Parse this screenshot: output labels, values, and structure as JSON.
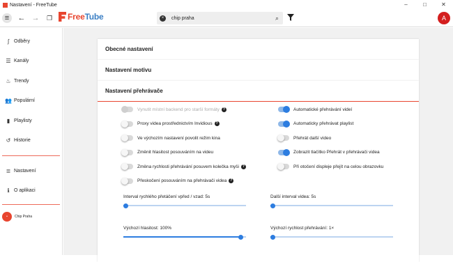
{
  "window": {
    "title": "Nastavení - FreeTube",
    "minimize": "–",
    "maximize": "□",
    "close": "✕"
  },
  "topbar": {
    "logo_part1": "Free",
    "logo_part2": "Tube",
    "search": {
      "value": "chip praha",
      "clear_glyph": "×",
      "search_glyph": "⌕"
    },
    "avatar_letter": "A",
    "back_glyph": "←",
    "forward_glyph": "→",
    "menu_glyph": "≡",
    "new_window_glyph": "❐"
  },
  "sidebar": {
    "items": [
      {
        "label": "Odběry",
        "icon": "rss-icon",
        "glyph": "ʃ"
      },
      {
        "label": "Kanály",
        "icon": "list-icon",
        "glyph": "☰"
      },
      {
        "label": "Trendy",
        "icon": "fire-icon",
        "glyph": "♨"
      },
      {
        "label": "Populární",
        "icon": "users-icon",
        "glyph": "👥"
      },
      {
        "label": "Playlisty",
        "icon": "bookmark-icon",
        "glyph": "▮"
      },
      {
        "label": "Historie",
        "icon": "history-icon",
        "glyph": "↺"
      }
    ],
    "bottom_items": [
      {
        "label": "Nastavení",
        "icon": "sliders-icon",
        "glyph": "≣"
      },
      {
        "label": "O aplikaci",
        "icon": "info-icon",
        "glyph": "ℹ"
      }
    ],
    "profile": {
      "label": "Chip Praha",
      "initial": "•"
    }
  },
  "sections": {
    "general": "Obecné nastavení",
    "theme": "Nastavení motivu",
    "player": "Nastavení přehrávače"
  },
  "player_options_left": [
    {
      "label": "Vynutit místní backend pro starší formáty",
      "on": false,
      "disabled": true,
      "help": true
    },
    {
      "label": "Proxy videa prostřednictvím Invidious",
      "on": false,
      "disabled": false,
      "help": true
    },
    {
      "label": "Ve výchozím nastavení povolit režim kina",
      "on": false,
      "disabled": false,
      "help": false
    },
    {
      "label": "Změnit hlasitost posouváním na videu",
      "on": false,
      "disabled": false,
      "help": false
    },
    {
      "label": "Změna rychlosti přehrávání posuvem kolečka myši",
      "on": false,
      "disabled": false,
      "help": true
    },
    {
      "label": "Přeskočení posouváním na přehrávači videa",
      "on": false,
      "disabled": false,
      "help": true
    }
  ],
  "player_options_right": [
    {
      "label": "Automatické přehrávání videí",
      "on": true
    },
    {
      "label": "Automaticky přehrávat playlist",
      "on": true
    },
    {
      "label": "Přehrát další video",
      "on": false
    },
    {
      "label": "Zobrazit tlačítko Přehrát v přehrávači videa",
      "on": true
    },
    {
      "label": "Při otočení displeje přejít na celou obrazovku",
      "on": false
    }
  ],
  "sliders": [
    {
      "label": "Interval rychlého přetáčení vpřed / vzad: 5s",
      "fraction": 0.0
    },
    {
      "label": "Další interval videa: 5s",
      "fraction": 0.0
    },
    {
      "label": "Výchozí hlasitost: 100%",
      "fraction": 1.0
    },
    {
      "label": "Výchozí rychlost přehrávání: 1×",
      "fraction": 0.0
    }
  ],
  "help_glyph": "?",
  "colors": {
    "accent": "#e8452f",
    "toggle_on": "#2d7de0",
    "avatar": "#d41e1e"
  }
}
